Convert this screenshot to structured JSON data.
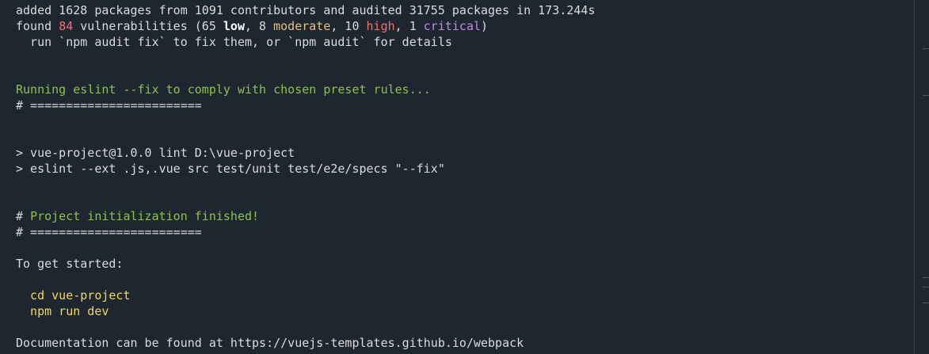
{
  "terminal": {
    "line1": "added 1628 packages from 1091 contributors and audited 31755 packages in 173.244s",
    "line2": {
      "prefix": "found ",
      "count": "84",
      "mid1": " vulnerabilities (65 ",
      "low": "low",
      "mid2": ", 8 ",
      "moderate": "moderate",
      "mid3": ", 10 ",
      "high": "high",
      "mid4": ", 1 ",
      "critical": "critical",
      "suffix": ")"
    },
    "line3": "  run `npm audit fix` to fix them, or `npm audit` for details",
    "eslint_running": "Running eslint --fix to comply with chosen preset rules...",
    "separator1": "# ========================",
    "cmd1": "> vue-project@1.0.0 lint D:\\vue-project",
    "cmd2": "> eslint --ext .js,.vue src test/unit test/e2e/specs \"--fix\"",
    "finished": {
      "hash": "# ",
      "text": "Project initialization finished!"
    },
    "separator2": "# ========================",
    "get_started": "To get started:",
    "step1": "  cd vue-project",
    "step2": "  npm run dev",
    "docs": "Documentation can be found at https://vuejs-templates.github.io/webpack"
  },
  "colors": {
    "background": "#1e2630",
    "text": "#dcdcdc",
    "vuln_count": "#f47067",
    "moderate": "#e5c07b",
    "high": "#f47067",
    "critical": "#c586e8",
    "green": "#8ec24a",
    "commands": "#f0d95c"
  }
}
